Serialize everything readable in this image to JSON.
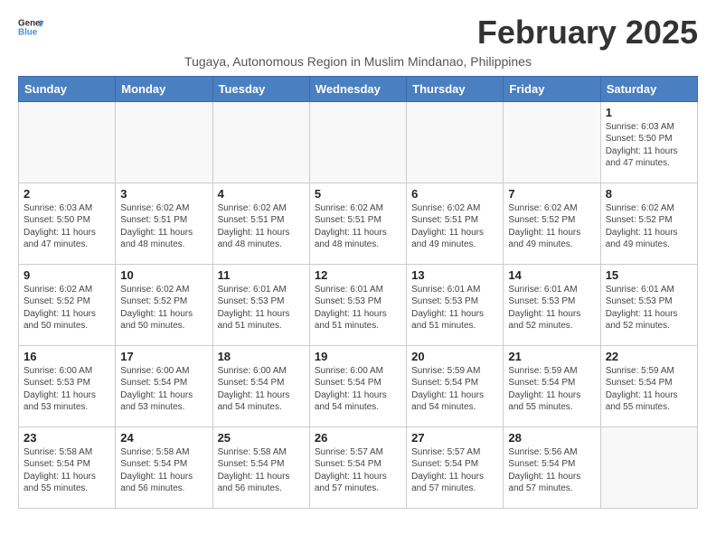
{
  "logo": {
    "line1": "General",
    "line2": "Blue"
  },
  "title": "February 2025",
  "subtitle": "Tugaya, Autonomous Region in Muslim Mindanao, Philippines",
  "days_of_week": [
    "Sunday",
    "Monday",
    "Tuesday",
    "Wednesday",
    "Thursday",
    "Friday",
    "Saturday"
  ],
  "weeks": [
    [
      {
        "day": "",
        "info": ""
      },
      {
        "day": "",
        "info": ""
      },
      {
        "day": "",
        "info": ""
      },
      {
        "day": "",
        "info": ""
      },
      {
        "day": "",
        "info": ""
      },
      {
        "day": "",
        "info": ""
      },
      {
        "day": "1",
        "info": "Sunrise: 6:03 AM\nSunset: 5:50 PM\nDaylight: 11 hours\nand 47 minutes."
      }
    ],
    [
      {
        "day": "2",
        "info": "Sunrise: 6:03 AM\nSunset: 5:50 PM\nDaylight: 11 hours\nand 47 minutes."
      },
      {
        "day": "3",
        "info": "Sunrise: 6:02 AM\nSunset: 5:51 PM\nDaylight: 11 hours\nand 48 minutes."
      },
      {
        "day": "4",
        "info": "Sunrise: 6:02 AM\nSunset: 5:51 PM\nDaylight: 11 hours\nand 48 minutes."
      },
      {
        "day": "5",
        "info": "Sunrise: 6:02 AM\nSunset: 5:51 PM\nDaylight: 11 hours\nand 48 minutes."
      },
      {
        "day": "6",
        "info": "Sunrise: 6:02 AM\nSunset: 5:51 PM\nDaylight: 11 hours\nand 49 minutes."
      },
      {
        "day": "7",
        "info": "Sunrise: 6:02 AM\nSunset: 5:52 PM\nDaylight: 11 hours\nand 49 minutes."
      },
      {
        "day": "8",
        "info": "Sunrise: 6:02 AM\nSunset: 5:52 PM\nDaylight: 11 hours\nand 49 minutes."
      }
    ],
    [
      {
        "day": "9",
        "info": "Sunrise: 6:02 AM\nSunset: 5:52 PM\nDaylight: 11 hours\nand 50 minutes."
      },
      {
        "day": "10",
        "info": "Sunrise: 6:02 AM\nSunset: 5:52 PM\nDaylight: 11 hours\nand 50 minutes."
      },
      {
        "day": "11",
        "info": "Sunrise: 6:01 AM\nSunset: 5:53 PM\nDaylight: 11 hours\nand 51 minutes."
      },
      {
        "day": "12",
        "info": "Sunrise: 6:01 AM\nSunset: 5:53 PM\nDaylight: 11 hours\nand 51 minutes."
      },
      {
        "day": "13",
        "info": "Sunrise: 6:01 AM\nSunset: 5:53 PM\nDaylight: 11 hours\nand 51 minutes."
      },
      {
        "day": "14",
        "info": "Sunrise: 6:01 AM\nSunset: 5:53 PM\nDaylight: 11 hours\nand 52 minutes."
      },
      {
        "day": "15",
        "info": "Sunrise: 6:01 AM\nSunset: 5:53 PM\nDaylight: 11 hours\nand 52 minutes."
      }
    ],
    [
      {
        "day": "16",
        "info": "Sunrise: 6:00 AM\nSunset: 5:53 PM\nDaylight: 11 hours\nand 53 minutes."
      },
      {
        "day": "17",
        "info": "Sunrise: 6:00 AM\nSunset: 5:54 PM\nDaylight: 11 hours\nand 53 minutes."
      },
      {
        "day": "18",
        "info": "Sunrise: 6:00 AM\nSunset: 5:54 PM\nDaylight: 11 hours\nand 54 minutes."
      },
      {
        "day": "19",
        "info": "Sunrise: 6:00 AM\nSunset: 5:54 PM\nDaylight: 11 hours\nand 54 minutes."
      },
      {
        "day": "20",
        "info": "Sunrise: 5:59 AM\nSunset: 5:54 PM\nDaylight: 11 hours\nand 54 minutes."
      },
      {
        "day": "21",
        "info": "Sunrise: 5:59 AM\nSunset: 5:54 PM\nDaylight: 11 hours\nand 55 minutes."
      },
      {
        "day": "22",
        "info": "Sunrise: 5:59 AM\nSunset: 5:54 PM\nDaylight: 11 hours\nand 55 minutes."
      }
    ],
    [
      {
        "day": "23",
        "info": "Sunrise: 5:58 AM\nSunset: 5:54 PM\nDaylight: 11 hours\nand 55 minutes."
      },
      {
        "day": "24",
        "info": "Sunrise: 5:58 AM\nSunset: 5:54 PM\nDaylight: 11 hours\nand 56 minutes."
      },
      {
        "day": "25",
        "info": "Sunrise: 5:58 AM\nSunset: 5:54 PM\nDaylight: 11 hours\nand 56 minutes."
      },
      {
        "day": "26",
        "info": "Sunrise: 5:57 AM\nSunset: 5:54 PM\nDaylight: 11 hours\nand 57 minutes."
      },
      {
        "day": "27",
        "info": "Sunrise: 5:57 AM\nSunset: 5:54 PM\nDaylight: 11 hours\nand 57 minutes."
      },
      {
        "day": "28",
        "info": "Sunrise: 5:56 AM\nSunset: 5:54 PM\nDaylight: 11 hours\nand 57 minutes."
      },
      {
        "day": "",
        "info": ""
      }
    ]
  ]
}
